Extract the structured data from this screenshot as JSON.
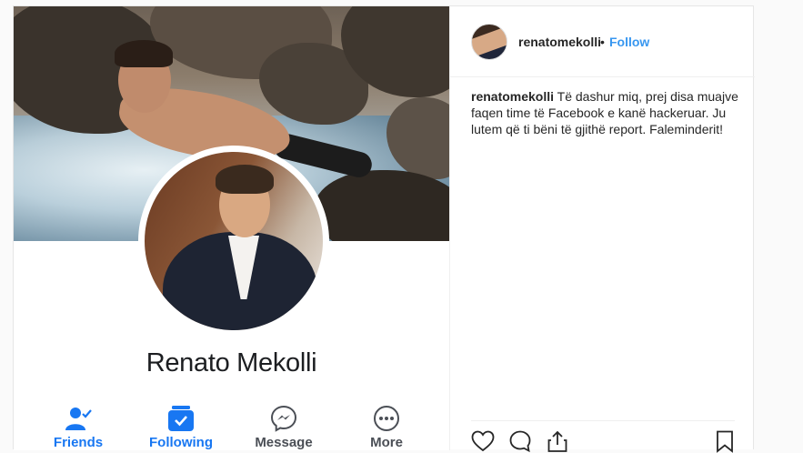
{
  "profile": {
    "name": "Renato Mekolli"
  },
  "actions": [
    {
      "label": "Friends",
      "icon": "friends-icon",
      "color": "#1877f2"
    },
    {
      "label": "Following",
      "icon": "following-icon",
      "color": "#1877f2"
    },
    {
      "label": "Message",
      "icon": "messenger-icon",
      "color": "#4b4f56"
    },
    {
      "label": "More",
      "icon": "more-icon",
      "color": "#4b4f56"
    }
  ],
  "post": {
    "username": "renatomekolli",
    "separator": "•",
    "follow_label": "Follow",
    "caption_user": "renatomekolli",
    "caption_text": " Të dashur miq, prej disa muajve faqen time të Facebook e kanë hackeruar. Ju lutem që ti bëni të gjithë report. Faleminderit!"
  },
  "colors": {
    "instagram_link": "#3897f0",
    "facebook_blue": "#1877f2"
  },
  "bottom_icons": [
    "heart-icon",
    "comment-icon",
    "share-icon",
    "bookmark-icon"
  ]
}
